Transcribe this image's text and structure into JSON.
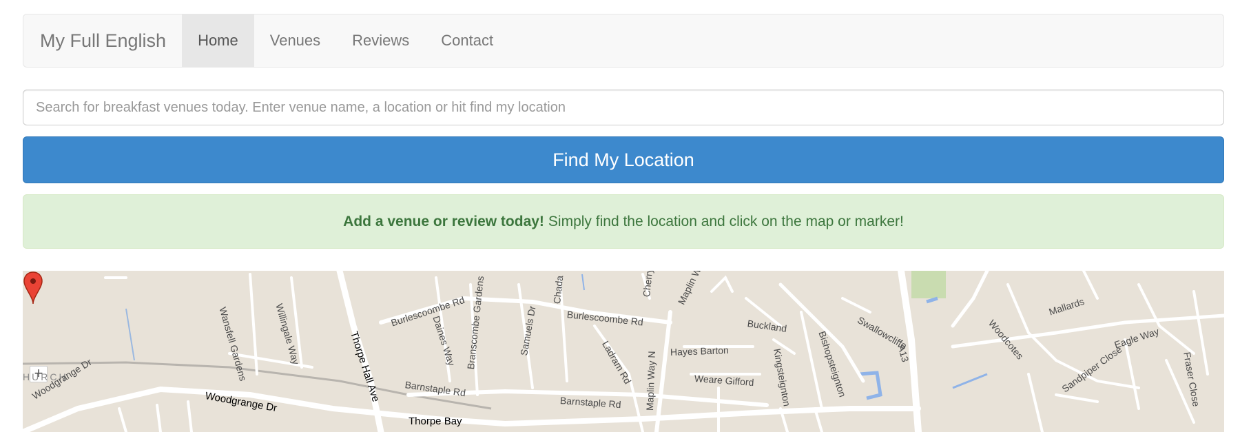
{
  "navbar": {
    "brand": "My Full English",
    "items": [
      {
        "label": "Home",
        "active": true
      },
      {
        "label": "Venues",
        "active": false
      },
      {
        "label": "Reviews",
        "active": false
      },
      {
        "label": "Contact",
        "active": false
      }
    ]
  },
  "search": {
    "placeholder": "Search for breakfast venues today. Enter venue name, a location or hit find my location",
    "value": ""
  },
  "find_button": {
    "label": "Find My Location"
  },
  "alert": {
    "bold": "Add a venue or review today!",
    "text": "Simply find the location and click on the map or marker!"
  },
  "map": {
    "zoom_in_label": "+",
    "labels": {
      "burlescoombe_rd_1": "Burlescoombe Rd",
      "burlescoombe_rd_2": "Burlescoombe Rd",
      "wansfell_gardens": "Wansfell Gardens",
      "willingale_way": "Willingale Way",
      "thorpe_hall_ave": "Thorpe Hall Ave",
      "daines_way": "Daines Way",
      "branscombe_gardens": "Branscombe Gardens",
      "samuels_dr": "Samuels Dr",
      "chadacre": "Chada",
      "cherry": "Cherry",
      "maplin_way": "Maplin W",
      "ladram_rd": "Ladram Rd",
      "hayes_barton": "Hayes Barton",
      "buckland": "Buckland",
      "kingsteignton": "Kingsteignton",
      "bishopsteignton": "Bishopsteignton",
      "swallowcliffe": "Swallowcliffe",
      "a13": "A13",
      "woodcotes": "Woodcotes",
      "mallards": "Mallards",
      "eagle_way": "Eagle Way",
      "fraser_close": "Fraser Close",
      "woodgrange_dr_1": "Woodgrange Dr",
      "woodgrange_dr_2": "Woodgrange Dr",
      "barnstaple_rd_1": "Barnstaple Rd",
      "barnstaple_rd_2": "Barnstaple Rd",
      "thorpe_bay": "Thorpe Bay",
      "weare_gifford": "Weare Gifford",
      "maplin_way_n": "Maplin Way N",
      "sandpiper_close": "Sandpiper Close",
      "church": "HURCH"
    }
  }
}
